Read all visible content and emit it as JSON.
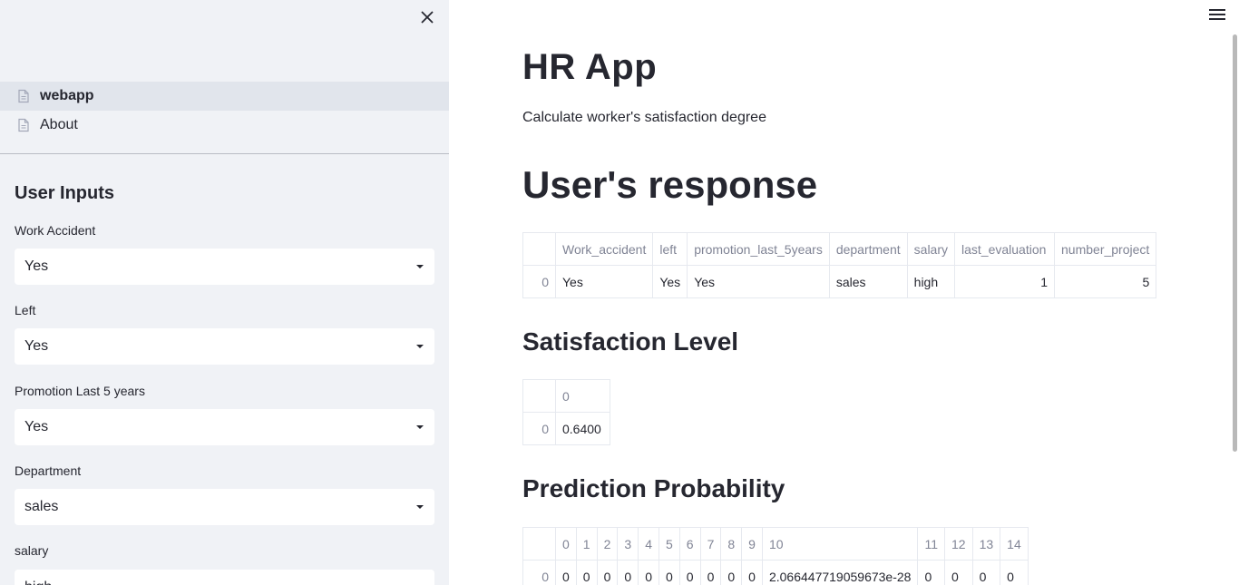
{
  "sidebar": {
    "nav": [
      {
        "label": "webapp",
        "active": true
      },
      {
        "label": "About",
        "active": false
      }
    ],
    "inputs_title": "User Inputs",
    "fields": [
      {
        "label": "Work Accident",
        "value": "Yes"
      },
      {
        "label": "Left",
        "value": "Yes"
      },
      {
        "label": "Promotion Last 5 years",
        "value": "Yes"
      },
      {
        "label": "Department",
        "value": "sales"
      },
      {
        "label": "salary",
        "value": "high"
      }
    ]
  },
  "main": {
    "title": "HR App",
    "subtitle": "Calculate worker's satisfaction degree",
    "response_heading": "User's response",
    "response_table": {
      "columns": [
        "Work_accident",
        "left",
        "promotion_last_5years",
        "department",
        "salary",
        "last_evaluation",
        "number_project"
      ],
      "rows": [
        {
          "index": "0",
          "cells": [
            "Yes",
            "Yes",
            "Yes",
            "sales",
            "high",
            "1",
            "5"
          ]
        }
      ]
    },
    "satisfaction_heading": "Satisfaction Level",
    "satisfaction_table": {
      "columns": [
        "0"
      ],
      "rows": [
        {
          "index": "0",
          "cells": [
            "0.6400"
          ]
        }
      ]
    },
    "prediction_heading": "Prediction Probability",
    "prediction_table": {
      "columns": [
        "0",
        "1",
        "2",
        "3",
        "4",
        "5",
        "6",
        "7",
        "8",
        "9",
        "10",
        "11",
        "12",
        "13",
        "14"
      ],
      "rows": [
        {
          "index": "0",
          "cells": [
            "0",
            "0",
            "0",
            "0",
            "0",
            "0",
            "0",
            "0",
            "0",
            "0",
            "2.066447719059673e-28",
            "0",
            "0",
            "0",
            "0"
          ]
        }
      ]
    }
  },
  "icons": {
    "close": "close-icon",
    "menu": "hamburger-menu-icon",
    "page": "document-icon"
  },
  "colors": {
    "sidebar_bg": "#f0f2f6",
    "text": "#262730",
    "muted": "#808495"
  }
}
